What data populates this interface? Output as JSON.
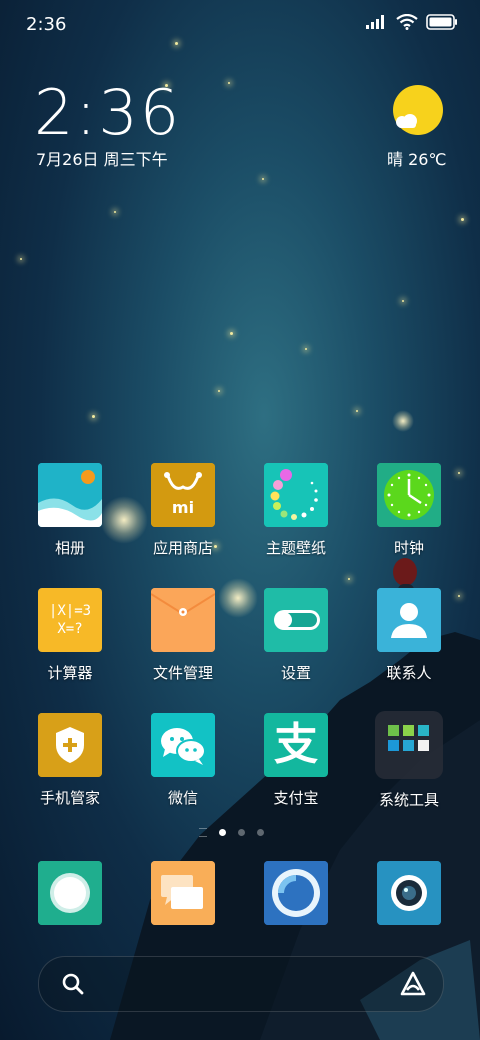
{
  "status_bar": {
    "time": "2:36"
  },
  "clock_widget": {
    "time": "2:36",
    "date": "7月26日 周三下午"
  },
  "weather_widget": {
    "condition_temp": "晴 26℃"
  },
  "apps": [
    {
      "label": "相册",
      "icon": "gallery-icon"
    },
    {
      "label": "应用商店",
      "icon": "app-store-icon"
    },
    {
      "label": "主题壁纸",
      "icon": "themes-icon"
    },
    {
      "label": "时钟",
      "icon": "clock-icon"
    },
    {
      "label": "计算器",
      "icon": "calculator-icon"
    },
    {
      "label": "文件管理",
      "icon": "file-manager-icon"
    },
    {
      "label": "设置",
      "icon": "settings-icon"
    },
    {
      "label": "联系人",
      "icon": "contacts-icon"
    },
    {
      "label": "手机管家",
      "icon": "security-icon"
    },
    {
      "label": "微信",
      "icon": "wechat-icon"
    },
    {
      "label": "支付宝",
      "icon": "alipay-icon"
    },
    {
      "label": "系统工具",
      "icon": "folder-icon"
    }
  ],
  "calculator_icon_text": {
    "line1": "|X|=3",
    "line2": "X=?"
  },
  "alipay_glyph": "支",
  "page_indicator": {
    "pages": 3,
    "current": 0
  },
  "dock": [
    {
      "icon": "phone-icon"
    },
    {
      "icon": "messages-icon"
    },
    {
      "icon": "browser-icon"
    },
    {
      "icon": "camera-icon"
    }
  ],
  "colors": {
    "gallery": "#1fb3c8",
    "app_store": "#d39a10",
    "themes": "#17c4b7",
    "clock": "#21ad86",
    "calculator": "#f7b927",
    "file_manager": "#fba659",
    "settings": "#1fbca7",
    "contacts": "#3ab3d9",
    "security": "#d8a018",
    "wechat": "#12c2c5",
    "alipay": "#13b79e",
    "phone": "#1fae8e",
    "messages": "#f9ae58",
    "browser": "#2d72c0",
    "camera": "#2792c1"
  }
}
